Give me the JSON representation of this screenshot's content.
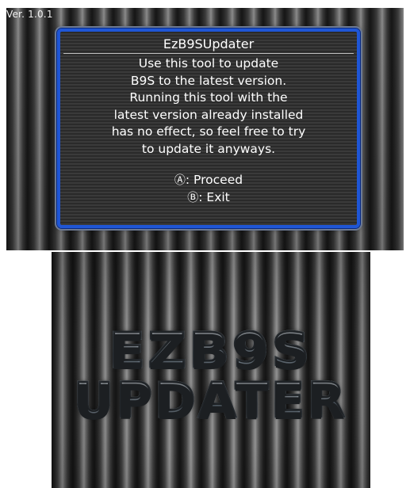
{
  "top": {
    "version": "Ver. 1.0.1",
    "dialog": {
      "title": "EzB9SUpdater",
      "lines": [
        "Use this tool to update",
        "B9S to the latest version.",
        "Running this tool with the",
        "latest version already installed",
        "has no effect, so feel free to try",
        "to update it anyways."
      ],
      "options": [
        {
          "glyph": "Ⓐ",
          "label": ": Proceed"
        },
        {
          "glyph": "Ⓑ",
          "label": ": Exit"
        }
      ]
    }
  },
  "bottom": {
    "logo_line1": "EZB9S",
    "logo_line2": "UPDATER"
  },
  "colors": {
    "dialog_border": "#1f56d6",
    "text": "#ffffff"
  }
}
